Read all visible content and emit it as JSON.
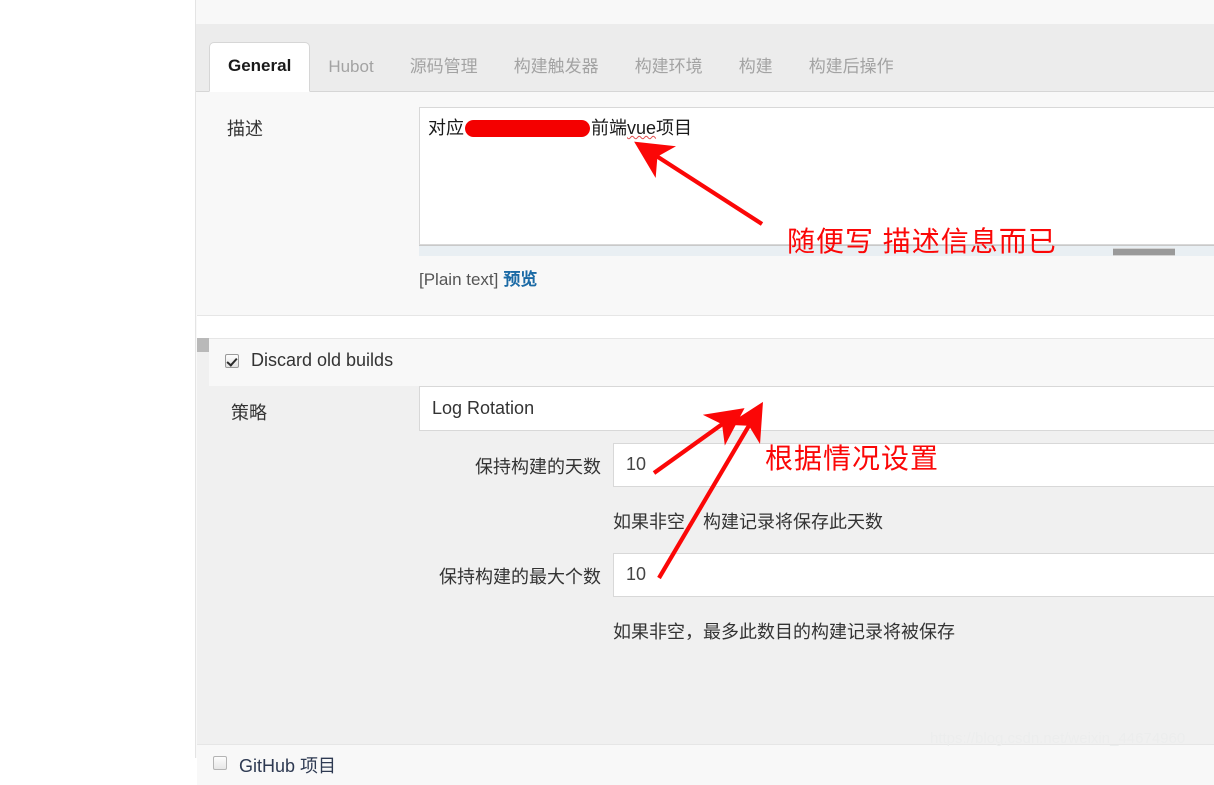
{
  "tabs": [
    {
      "label": "General",
      "active": true
    },
    {
      "label": "Hubot",
      "active": false
    },
    {
      "label": "源码管理",
      "active": false
    },
    {
      "label": "构建触发器",
      "active": false
    },
    {
      "label": "构建环境",
      "active": false
    },
    {
      "label": "构建",
      "active": false
    },
    {
      "label": "构建后操作",
      "active": false
    }
  ],
  "description": {
    "label": "描述",
    "value_prefix": "对应",
    "value_suffix": "前端",
    "value_spell": "vue",
    "value_tail": "项目",
    "markup_type": "[Plain text]",
    "preview_link": "预览"
  },
  "discard": {
    "checkbox_label": "Discard old builds",
    "checked": true,
    "strategy_label": "策略",
    "strategy_value": "Log Rotation",
    "days_label": "保持构建的天数",
    "days_value": "10",
    "days_help": "如果非空，构建记录将保存此天数",
    "max_label": "保持构建的最大个数",
    "max_value": "10",
    "max_help": "如果非空，最多此数目的构建记录将被保存"
  },
  "github": {
    "label": "GitHub 项目",
    "checked": false
  },
  "annotations": [
    {
      "text": "随便写 描述信息而已"
    },
    {
      "text": "根据情况设置"
    }
  ],
  "watermark": "https://blog.csdn.net/weixin_44674960",
  "colors": {
    "annotation_red": "#fb0707",
    "redaction_red": "#f40000",
    "link_blue": "#1b6aa5"
  }
}
